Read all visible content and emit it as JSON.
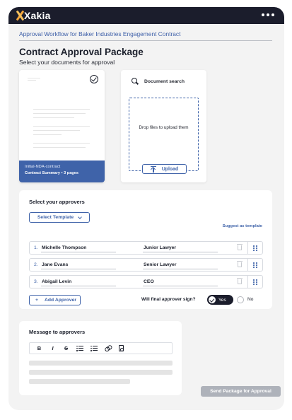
{
  "app": {
    "logo_text": "Xakia",
    "menu_icon": "more-icon"
  },
  "breadcrumb": "Approval Workflow for Baker Industries Engagement Contract",
  "page": {
    "title": "Contract Approval Package",
    "subtitle": "Select your documents for approval"
  },
  "document": {
    "name": "Initial-NDA-contract",
    "meta": "Contract Summary  •  3 pages",
    "selected": true
  },
  "upload": {
    "search_label": "Document search",
    "drop_text": "Drop files to upload them",
    "upload_label": "Upload"
  },
  "approvers": {
    "title": "Select your approvers",
    "template_button": "Select Template",
    "suggest_link": "Suggest as template",
    "rows": [
      {
        "num": "1.",
        "name": "Michelle Thompson",
        "role": "Junior Lawyer"
      },
      {
        "num": "2.",
        "name": "Jane Evans",
        "role": "Senior Lawyer"
      },
      {
        "num": "3.",
        "name": "Abigail Levin",
        "role": "CEO"
      }
    ],
    "add_button": "Add Approver",
    "add_symbol": "+",
    "final_question": "Will final approver sign?",
    "yes_label": "Yes",
    "no_label": "No",
    "final_selected": "Yes"
  },
  "message": {
    "title": "Message to approvers",
    "toolbar": {
      "bold": "B",
      "italic": "I",
      "strike": "S"
    }
  },
  "send_button": "Send Package for Approval"
}
